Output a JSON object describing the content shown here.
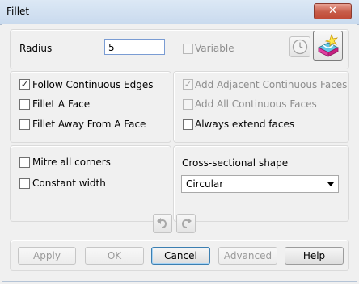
{
  "window": {
    "title": "Fillet",
    "close_icon": "✕"
  },
  "radius": {
    "label": "Radius",
    "value": "5",
    "variable_label": "Variable",
    "variable_checked": false,
    "variable_enabled": false
  },
  "tools": {
    "clock_icon": "clock-icon",
    "fillet_preview_icon": "fillet-preview-icon"
  },
  "edges": {
    "follow_continuous": {
      "label": "Follow Continuous Edges",
      "checked": true,
      "mark": "✓"
    },
    "fillet_a_face": {
      "label": "Fillet A Face",
      "checked": false
    },
    "fillet_away_from_face": {
      "label": "Fillet Away From A Face",
      "checked": false
    }
  },
  "faces": {
    "add_adjacent": {
      "label": "Add Adjacent Continuous Faces",
      "checked": true,
      "enabled": false,
      "mark": "✓"
    },
    "add_all": {
      "label": "Add All Continuous Faces",
      "checked": false,
      "enabled": false
    },
    "always_extend": {
      "label": "Always extend faces",
      "checked": false,
      "enabled": true
    }
  },
  "corners": {
    "mitre_all": {
      "label": "Mitre all corners",
      "checked": false
    },
    "constant_width": {
      "label": "Constant width",
      "checked": false
    }
  },
  "shape": {
    "label": "Cross-sectional shape",
    "selected": "Circular"
  },
  "history": {
    "undo_icon": "undo-icon",
    "redo_icon": "redo-icon"
  },
  "buttons": {
    "apply": "Apply",
    "ok": "OK",
    "cancel": "Cancel",
    "advanced": "Advanced",
    "help": "Help"
  }
}
